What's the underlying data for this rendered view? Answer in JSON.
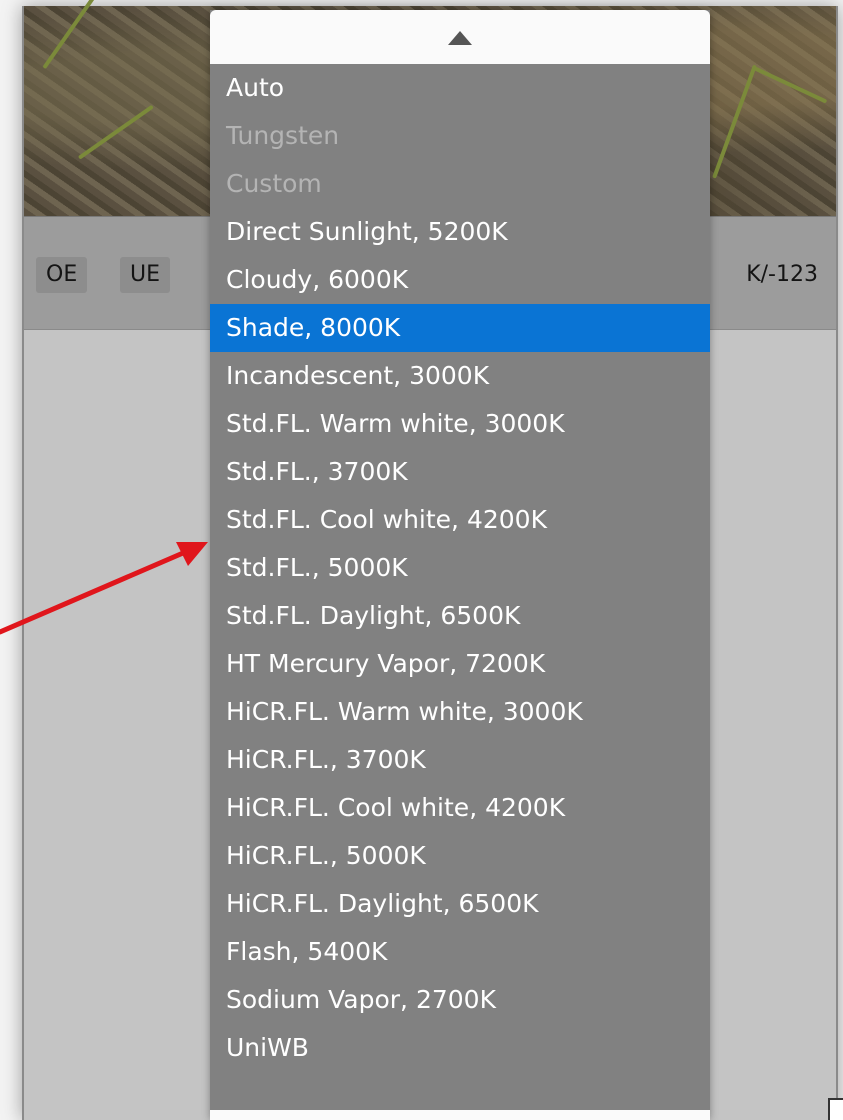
{
  "toolbar": {
    "oe_label": "OE",
    "ue_label": "UE",
    "readout_suffix": "K/-123"
  },
  "dropdown": {
    "scroll_up_icon": "triangle-up-icon",
    "items": [
      {
        "label": "Auto",
        "state": "normal"
      },
      {
        "label": "Tungsten",
        "state": "disabled"
      },
      {
        "label": "Custom",
        "state": "disabled"
      },
      {
        "label": "Direct Sunlight, 5200K",
        "state": "normal"
      },
      {
        "label": "Cloudy, 6000K",
        "state": "normal"
      },
      {
        "label": "Shade, 8000K",
        "state": "selected"
      },
      {
        "label": "Incandescent, 3000K",
        "state": "normal"
      },
      {
        "label": "Std.FL. Warm white, 3000K",
        "state": "normal"
      },
      {
        "label": "Std.FL., 3700K",
        "state": "normal"
      },
      {
        "label": "Std.FL. Cool white, 4200K",
        "state": "normal"
      },
      {
        "label": "Std.FL., 5000K",
        "state": "normal"
      },
      {
        "label": "Std.FL. Daylight, 6500K",
        "state": "normal"
      },
      {
        "label": "HT Mercury Vapor, 7200K",
        "state": "normal"
      },
      {
        "label": "HiCR.FL. Warm white, 3000K",
        "state": "normal"
      },
      {
        "label": "HiCR.FL., 3700K",
        "state": "normal"
      },
      {
        "label": "HiCR.FL. Cool white, 4200K",
        "state": "normal"
      },
      {
        "label": "HiCR.FL., 5000K",
        "state": "normal"
      },
      {
        "label": "HiCR.FL. Daylight, 6500K",
        "state": "normal"
      },
      {
        "label": "Flash, 5400K",
        "state": "normal"
      },
      {
        "label": "Sodium Vapor, 2700K",
        "state": "normal"
      },
      {
        "label": "UniWB",
        "state": "normal"
      }
    ]
  },
  "colors": {
    "menu_background": "#818181",
    "selected_highlight": "#0a74d4",
    "annotation_arrow": "#e0161c"
  }
}
